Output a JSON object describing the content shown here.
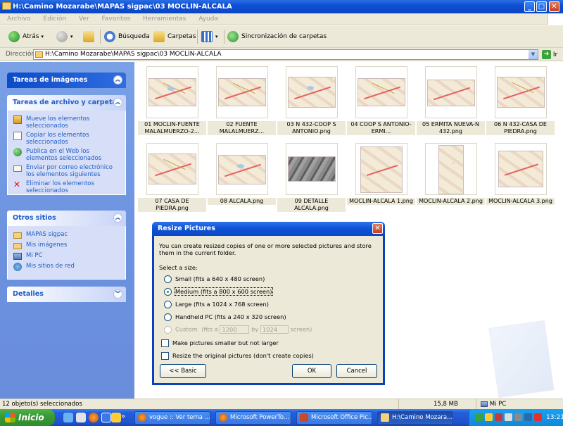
{
  "window": {
    "title": "H:\\Camino Mozarabe\\MAPAS sigpac\\03 MOCLIN-ALCALA",
    "min_label": "_",
    "max_label": "□",
    "close_label": "✕"
  },
  "menu": [
    "Archivo",
    "Edición",
    "Ver",
    "Favoritos",
    "Herramientas",
    "Ayuda"
  ],
  "toolbar": {
    "back": "Atrás",
    "search": "Búsqueda",
    "folders": "Carpetas",
    "sync": "Sincronización de carpetas"
  },
  "address": {
    "label": "Dirección",
    "value": "H:\\Camino Mozarabe\\MAPAS sigpac\\03 MOCLIN-ALCALA",
    "go": "Ir"
  },
  "sidebar": {
    "image_tasks": {
      "title": "Tareas de imágenes"
    },
    "file_tasks": {
      "title": "Tareas de archivo y carpeta",
      "items": [
        "Mueve los elementos seleccionados",
        "Copiar los elementos seleccionados",
        "Publica en el Web los elementos seleccionados",
        "Enviar por correo electrónico los elementos siguientes",
        "Eliminar los elementos seleccionados"
      ]
    },
    "other_places": {
      "title": "Otros sitios",
      "items": [
        "MAPAS sigpac",
        "Mis imágenes",
        "Mi PC",
        "Mis sitios de red"
      ]
    },
    "details": {
      "title": "Detalles"
    }
  },
  "files": [
    "01 MOCLIN-FUENTE MALALMUERZO-2...",
    "02 FUENTE MALALMUERZ...",
    "03 N 432-COOP S ANTONIO.png",
    "04 COOP S ANTONIO-ERMI...",
    "05 ERMITA NUEVA-N 432.png",
    "06 N 432-CASA DE PIEDRA.png",
    "07 CASA DE PIEDRA.png",
    "08 ALCALA.png",
    "09 DETALLE ALCALA.png",
    "MOCLIN-ALCALA 1.png",
    "MOCLIN-ALCALA 2.png",
    "MOCLIN-ALCALA 3.png"
  ],
  "dialog": {
    "title": "Resize Pictures",
    "close": "✕",
    "intro": "You can create resized copies of one or more selected pictures and store them in the current folder.",
    "select_size": "Select a size:",
    "options": [
      "Small (fits a 640 x 480 screen)",
      "Medium (fits a 800 x 600 screen)",
      "Large (fits a 1024 x 768 screen)",
      "Handheld PC (fits a 240 x 320 screen)",
      "Custom"
    ],
    "selected_option": "Medium (fits a 800 x 600 screen)",
    "custom": {
      "fits_a": "(fits a",
      "width": "1200",
      "by": "by",
      "height": "1024",
      "screen": "screen)"
    },
    "checkbox_smaller": "Make pictures smaller but not larger",
    "checkbox_original": "Resize the original pictures (don't create copies)",
    "btn_basic": "<< Basic",
    "btn_ok": "OK",
    "btn_cancel": "Cancel"
  },
  "status": {
    "selected": "12 objeto(s) seleccionados",
    "size": "15,8 MB",
    "location": "Mi PC"
  },
  "taskbar": {
    "start": "Inicio",
    "chevron": "»",
    "tasks": [
      "vogue :: Ver tema ...",
      "Microsoft PowerTo...",
      "Microsoft Office Pic...",
      "H:\\Camino Mozara..."
    ],
    "clock": "13:21"
  }
}
